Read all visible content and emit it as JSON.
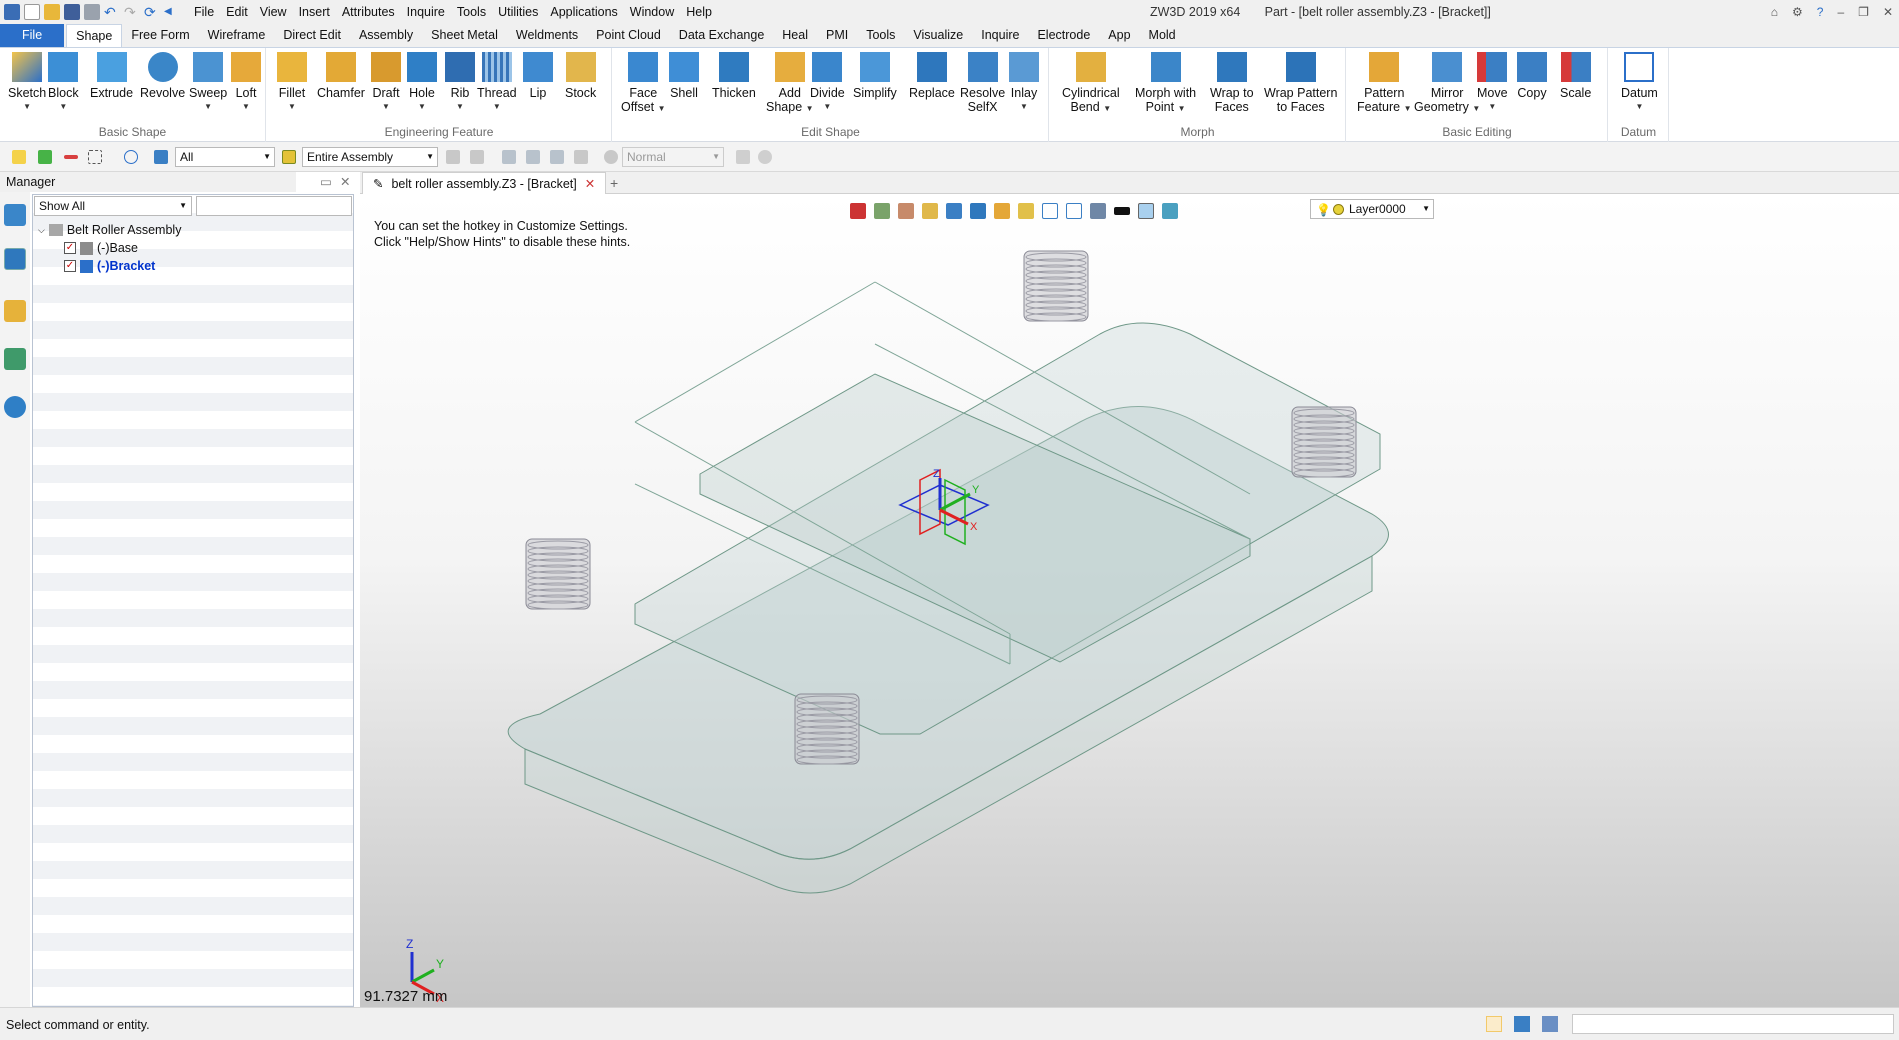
{
  "titlebar": {
    "menu": [
      "File",
      "Edit",
      "View",
      "Insert",
      "Attributes",
      "Inquire",
      "Tools",
      "Utilities",
      "Applications",
      "Window",
      "Help"
    ],
    "app_name": "ZW3D 2019  x64",
    "document_title": "Part - [belt roller assembly.Z3 - [Bracket]]"
  },
  "ribbon_tabs": [
    "File",
    "Shape",
    "Free Form",
    "Wireframe",
    "Direct Edit",
    "Assembly",
    "Sheet Metal",
    "Weldments",
    "Point Cloud",
    "Data Exchange",
    "Heal",
    "PMI",
    "Tools",
    "Visualize",
    "Inquire",
    "Electrode",
    "App",
    "Mold"
  ],
  "ribbon": {
    "groups": [
      {
        "name": "Basic Shape",
        "buttons": [
          [
            "Sketch",
            ""
          ],
          [
            "Block",
            ""
          ],
          [
            "Extrude",
            ""
          ],
          [
            "Revolve",
            ""
          ],
          [
            "Sweep",
            ""
          ],
          [
            "Loft",
            ""
          ]
        ]
      },
      {
        "name": "Engineering Feature",
        "buttons": [
          [
            "Fillet",
            ""
          ],
          [
            "Chamfer",
            ""
          ],
          [
            "Draft",
            ""
          ],
          [
            "Hole",
            ""
          ],
          [
            "Rib",
            ""
          ],
          [
            "Thread",
            ""
          ],
          [
            "Lip",
            ""
          ],
          [
            "Stock",
            ""
          ]
        ]
      },
      {
        "name": "Edit Shape",
        "buttons": [
          [
            "Face",
            "Offset"
          ],
          [
            "Shell",
            ""
          ],
          [
            "Thicken",
            ""
          ],
          [
            "Add",
            "Shape"
          ],
          [
            "Divide",
            ""
          ],
          [
            "Simplify",
            ""
          ],
          [
            "Replace",
            ""
          ],
          [
            "Resolve",
            "SelfX"
          ],
          [
            "Inlay",
            ""
          ]
        ]
      },
      {
        "name": "Morph",
        "buttons": [
          [
            "Cylindrical",
            "Bend"
          ],
          [
            "Morph with",
            "Point"
          ],
          [
            "Wrap to",
            "Faces"
          ],
          [
            "Wrap Pattern",
            "to Faces"
          ]
        ]
      },
      {
        "name": "Basic Editing",
        "buttons": [
          [
            "Pattern",
            "Feature"
          ],
          [
            "Mirror",
            "Geometry"
          ],
          [
            "Move",
            ""
          ],
          [
            "Copy",
            ""
          ],
          [
            "Scale",
            ""
          ]
        ]
      },
      {
        "name": "Datum",
        "buttons": [
          [
            "Datum",
            ""
          ]
        ]
      }
    ]
  },
  "toolbar2": {
    "filter_value": "All",
    "scope_value": "Entire Assembly",
    "render_mode_value": "Normal"
  },
  "manager": {
    "title": "Manager",
    "filter": "Show All",
    "tree": [
      {
        "label": "Belt Roller Assembly",
        "level": 0
      },
      {
        "label": "(-)Base",
        "level": 1,
        "checked": true
      },
      {
        "label": "(-)Bracket",
        "level": 1,
        "checked": true,
        "active": true
      }
    ]
  },
  "document_tab": {
    "label": "belt roller assembly.Z3 - [Bracket]",
    "close": "✕",
    "add": "+"
  },
  "viewport": {
    "hint_line1": "You can set the hotkey in Customize Settings.",
    "hint_line2": "Click \"Help/Show Hints\" to disable these hints.",
    "layer": "Layer0000",
    "measurement": "91.7327 mm",
    "axes": {
      "x": "X",
      "y": "Y",
      "z": "Z"
    }
  },
  "status": {
    "prompt": "Select command or entity."
  },
  "colors": {
    "accent": "#2b6fc9",
    "active_tree": "#0033cc",
    "body": "#bfd1d1",
    "axis_x": "#e02020",
    "axis_y": "#20b020",
    "axis_z": "#2030d0"
  }
}
